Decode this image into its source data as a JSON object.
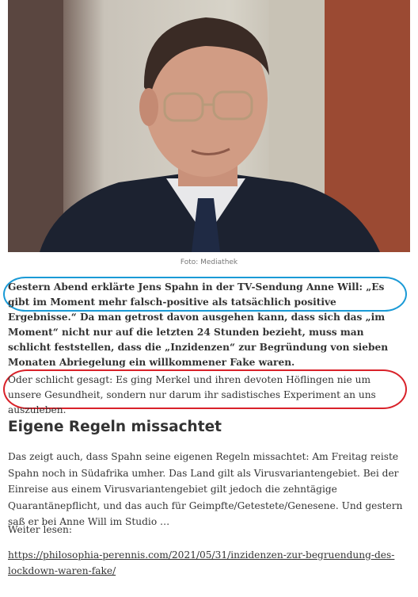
{
  "figure": {
    "caption": "Foto: Mediathek"
  },
  "article": {
    "paragraph_1": "Gestern Abend erklärte Jens Spahn in der TV-Sendung Anne Will: „Es gibt im Moment mehr falsch-positive als tatsächlich positive Ergebnisse.“ Da man getrost davon ausgehen kann, dass sich das „im Moment“ nicht nur auf die letzten 24 Stunden bezieht, muss man schlicht feststellen, dass die „Inzidenzen“ zur Begründung von sieben Monaten Abriegelung ein willkommener Fake waren.",
    "paragraph_2": "Oder schlicht gesagt: Es ging Merkel und ihren devoten Höflingen nie um unsere Gesundheit, sondern nur darum ihr sadistisches Experiment an uns auszuleben.",
    "heading": "Eigene Regeln missachtet",
    "paragraph_3": "Das zeigt auch, dass Spahn seine eigenen Regeln missachtet: Am Freitag reiste Spahn noch in Südafrika umher. Das Land gilt als Virusvariantengebiet. Bei der Einreise aus einem Virusvariantengebiet gilt jedoch die zehntägige Quarantänepflicht, und das auch für Geimpfte/Getestete/Genesene. Und gestern saß er bei Anne Will im Studio …",
    "read_more": "Weiter lesen:",
    "link": "https://philosophia-perennis.com/2021/05/31/inzidenzen-zur-begruendung-des-lockdown-waren-fake/"
  },
  "annotations": {
    "blue_color": "#1a9ad6",
    "red_color": "#d9222a"
  }
}
